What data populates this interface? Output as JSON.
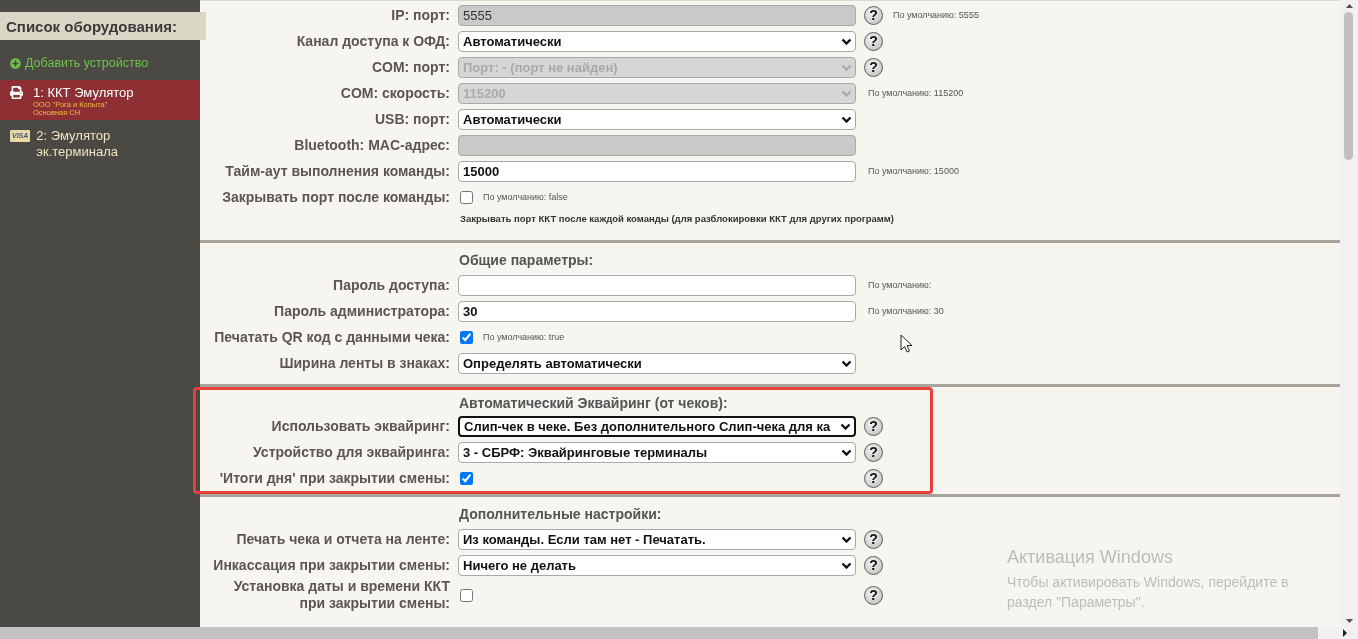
{
  "sidebar": {
    "title": "Список оборудования:",
    "add_button": "Добавить устройство",
    "devices": [
      {
        "title": "1: ККТ Эмулятор",
        "kind": "printer",
        "selected": true,
        "details": [
          "ООО \"Рога и Копыта\"",
          "Основная СН"
        ]
      },
      {
        "title": "2: Эмулятор эк.терминала",
        "kind": "card",
        "badge": "VISA",
        "selected": false
      }
    ]
  },
  "sections": [
    {
      "highlighted": false,
      "rows": [
        {
          "label": "IP: порт:",
          "kind": "text",
          "value": "5555",
          "disabled": true,
          "focused": false,
          "help": "?",
          "hint": "По умолчанию: 5555"
        },
        {
          "label": "Канал доступа к ОФД:",
          "kind": "select",
          "value": "Автоматически",
          "disabled": false,
          "focused": false,
          "help": "?"
        },
        {
          "label": "COM: порт:",
          "kind": "select",
          "value": "Порт: - (порт не найден)",
          "disabled": true,
          "focused": false,
          "help": "?"
        },
        {
          "label": "COM: скорость:",
          "kind": "select",
          "value": "115200",
          "disabled": true,
          "focused": false,
          "hint": "По умолчанию: 115200"
        },
        {
          "label": "USB: порт:",
          "kind": "select",
          "value": "Автоматически",
          "disabled": false,
          "focused": false
        },
        {
          "label": "Bluetooth: MAC-адрес:",
          "kind": "text",
          "disabled": true,
          "focused": false
        },
        {
          "label": "Тайм-аут выполнения команды:",
          "kind": "text",
          "value": "15000",
          "disabled": false,
          "focused": false,
          "hint": "По умолчанию: 15000"
        },
        {
          "label": "Закрывать порт после команды:",
          "kind": "checkbox",
          "checked": false,
          "hint": "По умолчанию: false"
        }
      ],
      "note": "Закрывать порт ККТ после каждой команды (для разблокировки ККТ для других программ)"
    },
    {
      "title": "Общие параметры:",
      "highlighted": false,
      "rows": [
        {
          "label": "Пароль доступа:",
          "kind": "text",
          "disabled": false,
          "focused": false,
          "hint": "По умолчанию:"
        },
        {
          "label": "Пароль администратора:",
          "kind": "text",
          "value": "30",
          "disabled": false,
          "focused": false,
          "hint": "По умолчанию: 30"
        },
        {
          "label": "Печатать QR код с данными чека:",
          "kind": "checkbox",
          "checked": true,
          "hint": "По умолчанию: true"
        },
        {
          "label": "Ширина ленты в знаках:",
          "kind": "select",
          "value": "Определять автоматически",
          "disabled": false,
          "focused": false
        }
      ]
    },
    {
      "title": "Автоматический Эквайринг (от чеков):",
      "highlighted": true,
      "rows": [
        {
          "label": "Использовать эквайринг:",
          "kind": "select",
          "value": "Слип-чек в чеке. Без дополнительного Слип-чека для ка",
          "disabled": false,
          "focused": true,
          "help": "?"
        },
        {
          "label": "Устройство для эквайринга:",
          "kind": "select",
          "value": "3 - СБРФ: Эквайринговые терминалы",
          "disabled": false,
          "focused": false,
          "help": "?"
        },
        {
          "label": "'Итоги дня' при закрытии смены:",
          "kind": "checkbox",
          "checked": true,
          "help": "?"
        }
      ]
    },
    {
      "title": "Дополнительные настройки:",
      "highlighted": false,
      "rows": [
        {
          "label": "Печать чека и отчета на ленте:",
          "kind": "select",
          "value": "Из команды. Если там нет - Печатать.",
          "disabled": false,
          "focused": false,
          "help": "?"
        },
        {
          "label": "Инкассация при закрытии смены:",
          "kind": "select",
          "value": "Ничего не делать",
          "disabled": false,
          "focused": false,
          "help": "?"
        },
        {
          "label": "Установка даты и времени ККТ при закрытии смены:",
          "kind": "checkbox",
          "checked": false,
          "help": "?"
        }
      ]
    }
  ],
  "os_notice": {
    "title": "Активация Windows",
    "text": "Чтобы активировать Windows, перейдите в раздел \"Параметры\"."
  }
}
